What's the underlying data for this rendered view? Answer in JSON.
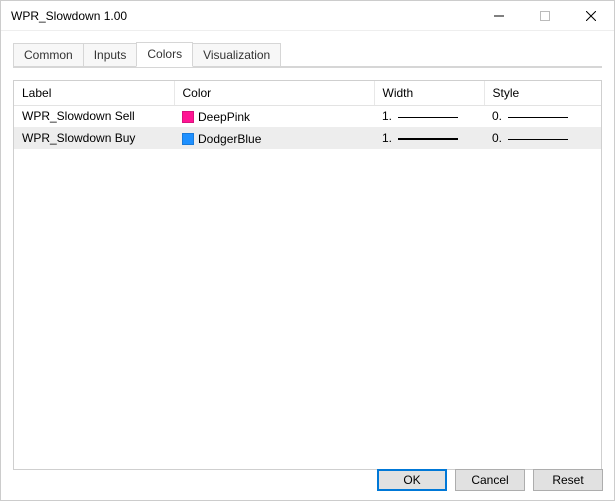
{
  "window": {
    "title": "WPR_Slowdown 1.00"
  },
  "tabs": [
    {
      "label": "Common"
    },
    {
      "label": "Inputs"
    },
    {
      "label": "Colors",
      "active": true
    },
    {
      "label": "Visualization"
    }
  ],
  "columns": {
    "label": "Label",
    "color": "Color",
    "width": "Width",
    "style": "Style"
  },
  "rows": [
    {
      "label": "WPR_Slowdown Sell",
      "color_name": "DeepPink",
      "color_hex": "#ff1493",
      "width_text": "1.",
      "style_text": "0."
    },
    {
      "label": "WPR_Slowdown Buy",
      "color_name": "DodgerBlue",
      "color_hex": "#1e90ff",
      "width_text": "1.",
      "style_text": "0."
    }
  ],
  "buttons": {
    "ok": "OK",
    "cancel": "Cancel",
    "reset": "Reset"
  }
}
